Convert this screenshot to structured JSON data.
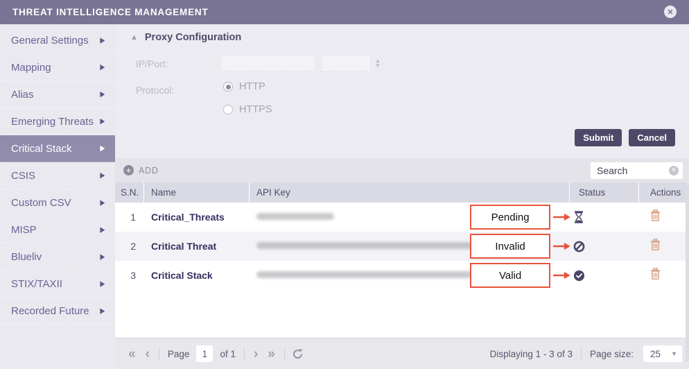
{
  "header": {
    "title": "THREAT INTELLIGENCE MANAGEMENT"
  },
  "sidebar": {
    "items": [
      {
        "label": "General Settings",
        "selected": false
      },
      {
        "label": "Mapping",
        "selected": false
      },
      {
        "label": "Alias",
        "selected": false
      },
      {
        "label": "Emerging Threats",
        "selected": false
      },
      {
        "label": "Critical Stack",
        "selected": true
      },
      {
        "label": "CSIS",
        "selected": false
      },
      {
        "label": "Custom CSV",
        "selected": false
      },
      {
        "label": "MISP",
        "selected": false
      },
      {
        "label": "Blueliv",
        "selected": false
      },
      {
        "label": "STIX/TAXII",
        "selected": false
      },
      {
        "label": "Recorded Future",
        "selected": false
      }
    ]
  },
  "proxy": {
    "title": "Proxy Configuration",
    "ip_port_label": "IP/Port:",
    "protocol_label": "Protocol:",
    "protocol_options": [
      {
        "label": "HTTP",
        "selected": true
      },
      {
        "label": "HTTPS",
        "selected": false
      }
    ],
    "submit_label": "Submit",
    "cancel_label": "Cancel"
  },
  "toolbar": {
    "add_label": "ADD",
    "search_placeholder": "Search"
  },
  "table": {
    "columns": {
      "sn": "S.N.",
      "name": "Name",
      "api_key": "API Key",
      "status": "Status",
      "actions": "Actions"
    },
    "rows": [
      {
        "sn": "1",
        "name": "Critical_Threats",
        "api_key_obscured": true,
        "status": "Pending",
        "status_icon": "hourglass-icon"
      },
      {
        "sn": "2",
        "name": "Critical Threat",
        "api_key_obscured": true,
        "status": "Invalid",
        "status_icon": "no-entry-icon"
      },
      {
        "sn": "3",
        "name": "Critical Stack",
        "api_key_obscured": true,
        "status": "Valid",
        "status_icon": "check-circle-icon"
      }
    ]
  },
  "pagination": {
    "page_label": "Page",
    "page_value": "1",
    "of_label": "of 1",
    "displaying": "Displaying 1 - 3 of 3",
    "page_size_label": "Page size:",
    "page_size_value": "25"
  },
  "colors": {
    "titlebar": "#7a7494",
    "sidebar_selected": "#918bac",
    "annotation_accent": "#e8523c",
    "status_icon": "#4b4669",
    "delete_icon": "#d9a287",
    "button": "#4d4968"
  }
}
